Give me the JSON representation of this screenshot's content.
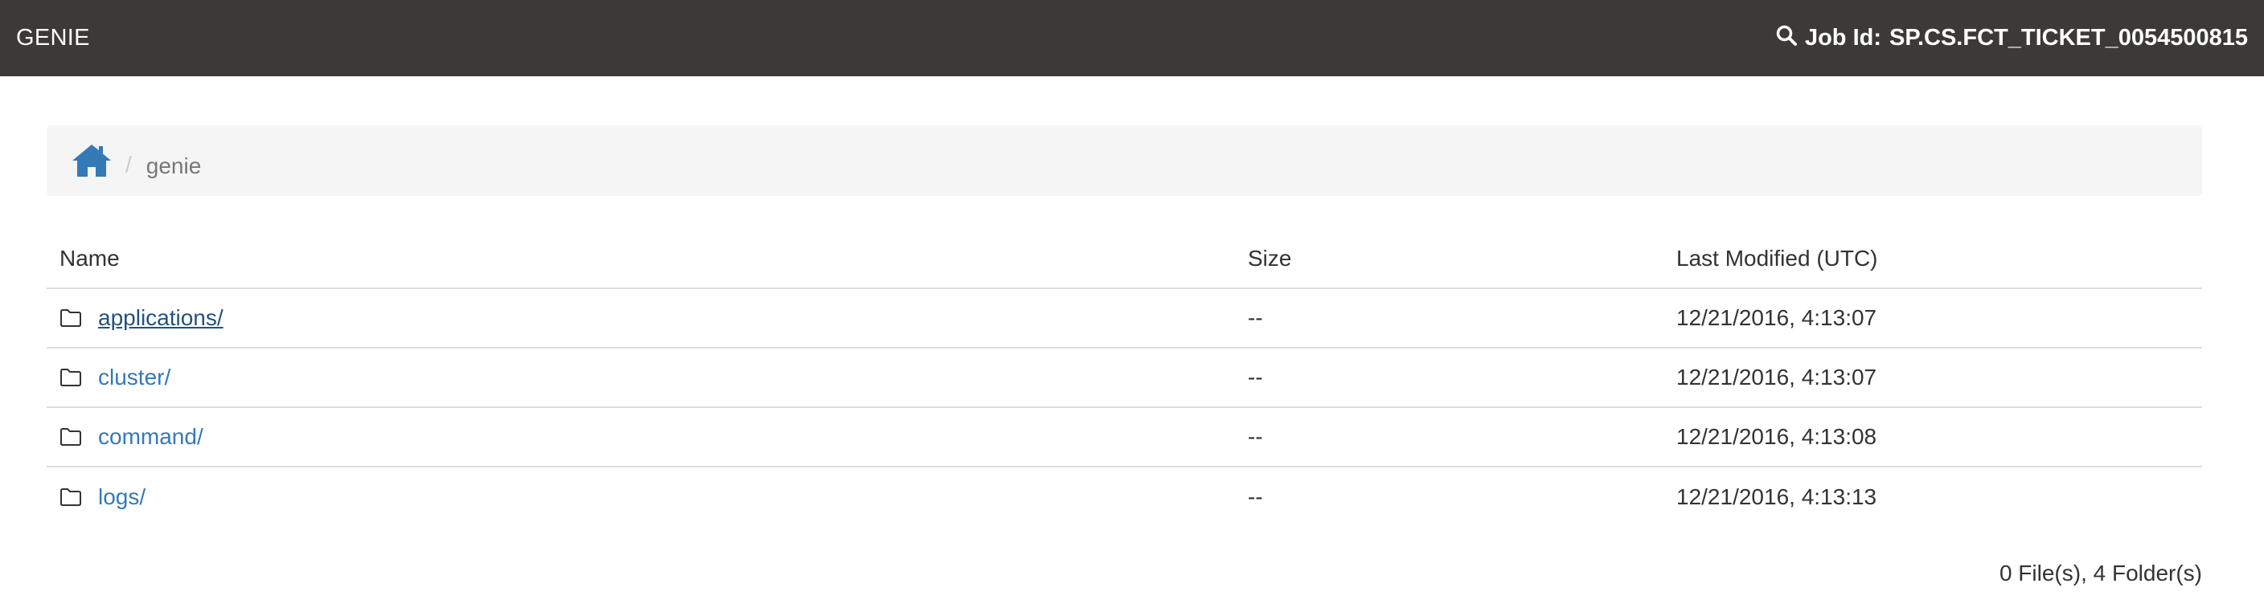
{
  "navbar": {
    "brand": "GENIE",
    "search_icon": "search-icon",
    "job_label": "Job Id:",
    "job_id": "SP.CS.FCT_TICKET_0054500815"
  },
  "breadcrumb": {
    "home_icon": "home-icon",
    "separator": "/",
    "current": "genie"
  },
  "table": {
    "headers": {
      "name": "Name",
      "size": "Size",
      "modified": "Last Modified (UTC)"
    },
    "rows": [
      {
        "icon": "folder-icon",
        "name": "applications/",
        "size": "--",
        "modified": "12/21/2016, 4:13:07"
      },
      {
        "icon": "folder-icon",
        "name": "cluster/",
        "size": "--",
        "modified": "12/21/2016, 4:13:07"
      },
      {
        "icon": "folder-icon",
        "name": "command/",
        "size": "--",
        "modified": "12/21/2016, 4:13:08"
      },
      {
        "icon": "folder-icon",
        "name": "logs/",
        "size": "--",
        "modified": "12/21/2016, 4:13:13"
      }
    ]
  },
  "summary": "0 File(s), 4 Folder(s)",
  "colors": {
    "navbar_bg": "#3b3a37",
    "link": "#337ab7",
    "link_hover": "#23527c",
    "breadcrumb_bg": "#f5f5f5"
  }
}
